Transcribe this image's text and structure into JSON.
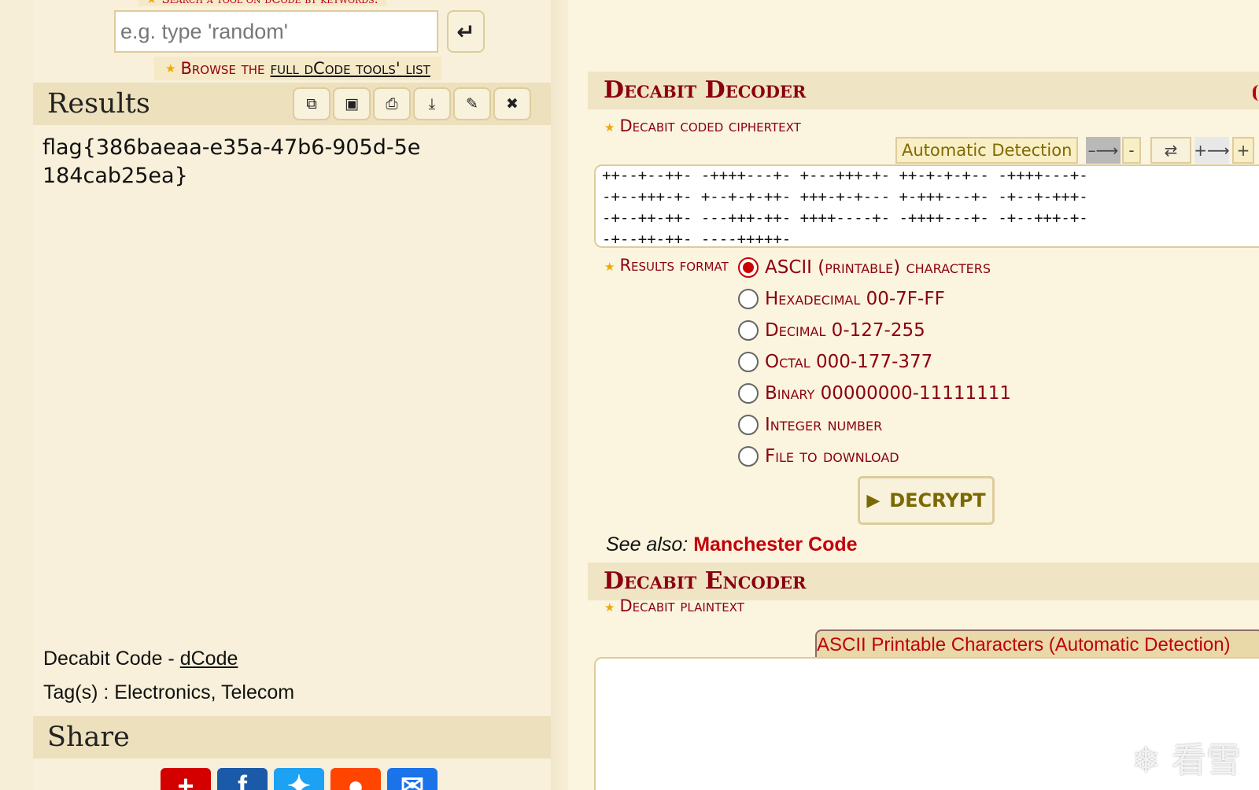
{
  "search": {
    "caption": "Search a tool on dCode by keywords:",
    "placeholder": "e.g. type 'random'",
    "go_icon": "return-arrow-icon",
    "go_glyph": "↵"
  },
  "browse": {
    "text": "Browse the",
    "link_text": "full dCode tools' list"
  },
  "results": {
    "title": "Results",
    "tools": [
      {
        "name": "copy-icon",
        "glyph": "⧉"
      },
      {
        "name": "screenshot-icon",
        "glyph": "▣"
      },
      {
        "name": "print-icon",
        "glyph": "⎙"
      },
      {
        "name": "download-icon",
        "glyph": "⤓"
      },
      {
        "name": "pin-icon",
        "glyph": "✎"
      },
      {
        "name": "close-icon",
        "glyph": "✖"
      }
    ],
    "output": "flag{386baeaa-e35a-47b6-905d-5e184cab25ea}"
  },
  "credit": {
    "name": "Decabit Code",
    "sep": " - ",
    "link": "dCode"
  },
  "tags": {
    "label": "Tag(s) : ",
    "values": "Electronics, Telecom"
  },
  "share": {
    "title": "Share",
    "buttons": [
      {
        "name": "share-plus-icon",
        "glyph": "+",
        "color": "#d40000"
      },
      {
        "name": "facebook-icon",
        "glyph": "f",
        "color": "#1b5aa8"
      },
      {
        "name": "twitter-icon",
        "glyph": "✦",
        "color": "#1da1f2"
      },
      {
        "name": "reddit-icon",
        "glyph": "●",
        "color": "#ff4500"
      },
      {
        "name": "email-icon",
        "glyph": "✉",
        "color": "#1a73e8"
      }
    ]
  },
  "decoder": {
    "title": "Decabit Decoder",
    "cipher_label": "Decabit coded ciphertext",
    "detect_label": "Automatic Detection",
    "mini_buttons": [
      {
        "name": "minus-arrow-button",
        "glyph": "–⟶"
      },
      {
        "name": "minus-button",
        "glyph": "-"
      },
      {
        "name": "swap-button",
        "glyph": "⇄"
      },
      {
        "name": "plus-arrow-button",
        "glyph": "+⟶"
      },
      {
        "name": "plus-button",
        "glyph": "+"
      }
    ],
    "cipher_lines": [
      "++--+--++- -++++---+- +---+++-+- ++-+-+-+-- -++++---+-",
      "-+--+++-+- +--+-+-++- +++-+-+--- +-+++---+- -+--+-+++-",
      "-+--++-++- ---+++-++- ++++----+- -++++---+- -+--+++-+-",
      "-+--++-++- ----+++++-"
    ],
    "format_label": "Results format",
    "formats": [
      {
        "label": "ASCII (printable) characters",
        "checked": true
      },
      {
        "label": "Hexadecimal 00-7F-FF",
        "checked": false
      },
      {
        "label": "Decimal 0-127-255",
        "checked": false
      },
      {
        "label": "Octal 000-177-377",
        "checked": false
      },
      {
        "label": "Binary 00000000-11111111",
        "checked": false
      },
      {
        "label": "Integer number",
        "checked": false
      },
      {
        "label": "File to download",
        "checked": false
      }
    ],
    "decrypt_label": "DECRYPT",
    "see_also_label": "See also:",
    "see_also_link": "Manchester Code"
  },
  "encoder": {
    "title": "Decabit Encoder",
    "plain_label": "Decabit plaintext",
    "format_btn": "ASCII Printable Characters (Automatic Detection)"
  },
  "watermark": "❄ 看雪"
}
